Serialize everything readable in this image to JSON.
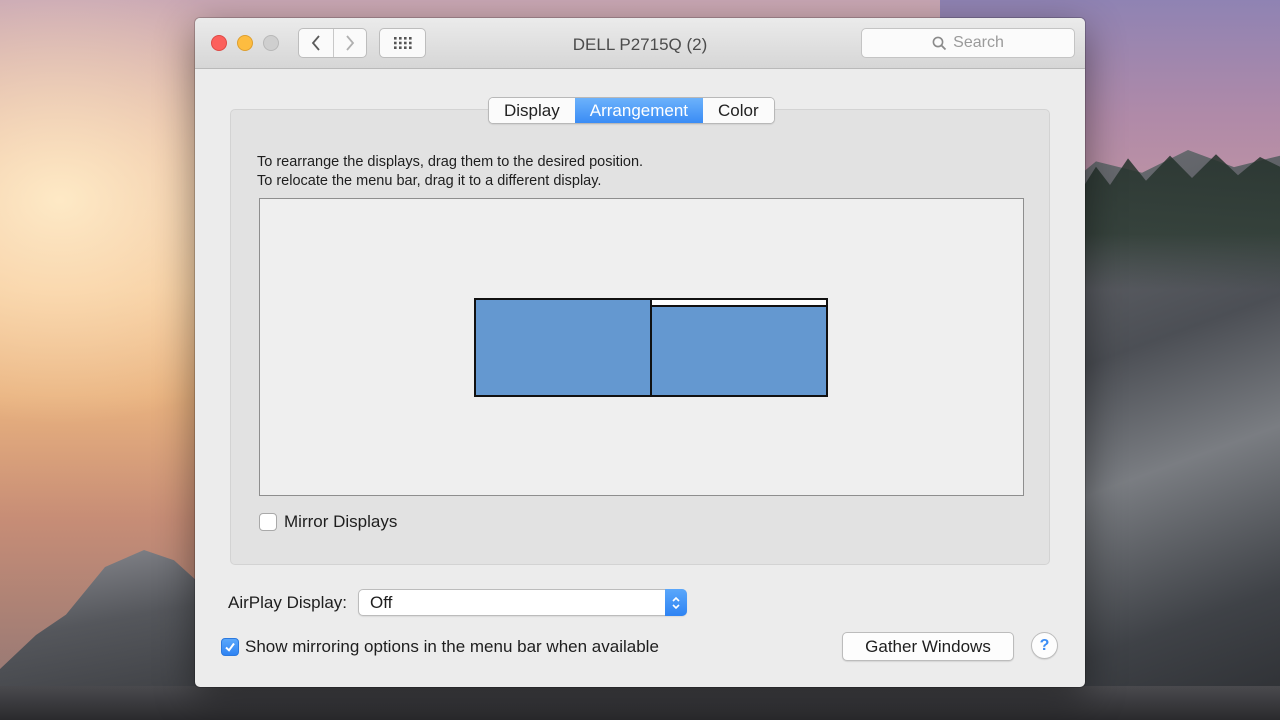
{
  "window": {
    "title": "DELL P2715Q (2)",
    "search_placeholder": "Search"
  },
  "tabs": [
    {
      "label": "Display",
      "active": false
    },
    {
      "label": "Arrangement",
      "active": true
    },
    {
      "label": "Color",
      "active": false
    }
  ],
  "arrangement": {
    "instruction_line1": "To rearrange the displays, drag them to the desired position.",
    "instruction_line2": "To relocate the menu bar, drag it to a different display.",
    "mirror_displays_label": "Mirror Displays",
    "mirror_displays_checked": false
  },
  "airplay": {
    "label": "AirPlay Display:",
    "selected": "Off"
  },
  "mirroring_option": {
    "label": "Show mirroring options in the menu bar when available",
    "checked": true
  },
  "buttons": {
    "gather_windows": "Gather Windows",
    "help": "?"
  },
  "colors": {
    "accent": "#3a8cf5",
    "display_fill": "#6498d0"
  }
}
